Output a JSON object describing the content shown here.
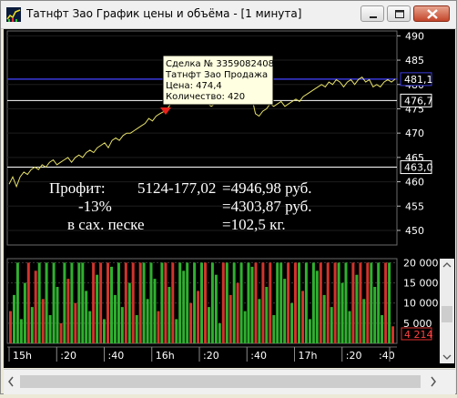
{
  "window": {
    "title": "Татнфт Зао График цены и объёма - [1 минута]"
  },
  "price_panel": {
    "y_ticks": [
      "490",
      "485",
      "480",
      "475",
      "470",
      "465",
      "460",
      "455",
      "450"
    ],
    "price_labels": {
      "blue": "481,1",
      "white1": "476,7",
      "white2": "463,0"
    },
    "tooltip": {
      "line1": "Сделка № 3359082408",
      "line2": "Татнфт Зао Продажа",
      "line3": "Цена: 474,4",
      "line4": "Количество: 420"
    },
    "overlay": {
      "r1c1": "Профит:",
      "r1c2": "5124-177,02",
      "r1c3": "=4946,98 руб.",
      "r2c1": "-13%",
      "r2c3": "=4303,87 руб.",
      "r3c1": "в сах. песке",
      "r3c3": "=102,5 кг."
    }
  },
  "volume_panel": {
    "y_ticks": [
      "20 000",
      "15 000",
      "10 000",
      "5 000"
    ],
    "last_volume": "4 214"
  },
  "time_axis": {
    "labels": [
      "15h",
      ":20",
      ":40",
      "16h",
      ":20",
      ":40",
      "17h",
      ":20",
      ":40"
    ]
  },
  "chart_data": [
    {
      "type": "line",
      "ylim": [
        447,
        491
      ],
      "x": [
        0,
        4,
        8,
        12,
        16,
        20,
        24,
        28,
        32,
        36,
        40,
        44,
        48,
        52,
        56,
        60,
        64,
        68,
        72,
        76,
        80,
        84,
        88,
        92,
        96,
        100,
        104,
        108,
        112,
        116,
        120,
        124,
        128,
        132,
        136,
        140,
        144,
        148,
        152,
        156,
        160,
        164,
        168,
        172,
        176,
        180,
        184,
        188,
        192,
        196,
        200,
        204,
        208,
        212,
        216,
        220,
        224,
        228,
        232,
        236,
        240,
        244,
        248,
        252,
        256,
        260,
        264,
        268,
        272,
        276,
        280,
        284,
        288,
        292,
        296,
        300,
        304,
        308,
        312,
        316,
        320,
        324,
        328,
        332,
        336,
        340,
        344,
        348,
        352,
        356,
        360,
        364,
        368,
        372,
        376,
        380,
        384,
        388,
        392,
        396,
        400,
        404,
        408,
        412,
        416,
        420
      ],
      "values": [
        459.5,
        461.0,
        459.0,
        461.0,
        462.0,
        461.5,
        462.5,
        463.0,
        462.5,
        463.5,
        463.0,
        464.0,
        464.5,
        463.5,
        464.0,
        464.5,
        465.0,
        464.0,
        465.0,
        465.5,
        465.0,
        466.0,
        466.5,
        466.0,
        467.0,
        467.5,
        468.0,
        467.0,
        468.5,
        469.0,
        468.5,
        469.5,
        470.0,
        470.0,
        470.5,
        471.0,
        471.5,
        472.0,
        473.0,
        472.5,
        473.5,
        474.0,
        474.4,
        475.0,
        476.0,
        476.5,
        476.5,
        477.0,
        477.5,
        477.0,
        477.5,
        477.0,
        476.5,
        476.0,
        476.0,
        475.5,
        476.0,
        476.5,
        477.0,
        478.5,
        477.5,
        476.5,
        477.0,
        476.0,
        477.0,
        476.5,
        477.5,
        474.0,
        473.5,
        474.5,
        475.0,
        476.0,
        475.5,
        476.0,
        476.5,
        475.5,
        476.0,
        476.5,
        477.0,
        476.5,
        477.5,
        478.0,
        478.5,
        479.0,
        479.5,
        480.0,
        479.5,
        480.5,
        480.0,
        481.0,
        480.5,
        479.5,
        480.5,
        481.0,
        480.0,
        481.0,
        481.5,
        480.5,
        481.0,
        479.5,
        480.0,
        479.5,
        480.5,
        481.0,
        480.5,
        481.1
      ]
    },
    {
      "type": "bar",
      "ylim": [
        0,
        21000
      ],
      "values": [
        8000,
        12000,
        20000,
        6000,
        15000,
        20000,
        9000,
        18000,
        20000,
        11000,
        20000,
        7000,
        20000,
        14000,
        5000,
        20000,
        16000,
        20000,
        10000,
        20000,
        20000,
        13000,
        8000,
        20000,
        17000,
        20000,
        6000,
        20000,
        19000,
        12000,
        20000,
        9000,
        20000,
        15000,
        20000,
        7000,
        20000,
        20000,
        11000,
        20000,
        16000,
        8000,
        20000,
        20000,
        14000,
        20000,
        6000,
        20000,
        18000,
        20000,
        10000,
        20000,
        13000,
        20000,
        20000,
        9000,
        20000,
        17000,
        5000,
        20000,
        20000,
        12000,
        20000,
        15000,
        20000,
        8000,
        20000,
        19000,
        20000,
        11000,
        20000,
        14000,
        20000,
        7000,
        20000,
        20000,
        16000,
        20000,
        10000,
        20000,
        20000,
        13000,
        20000,
        6000,
        20000,
        18000,
        20000,
        12000,
        20000,
        9000,
        20000,
        20000,
        15000,
        20000,
        8000,
        20000,
        17000,
        20000,
        11000,
        20000,
        20000,
        14000,
        20000,
        7000,
        20000,
        20000,
        4214
      ],
      "colors": [
        "#2fb02f",
        "#d0342c"
      ]
    }
  ]
}
